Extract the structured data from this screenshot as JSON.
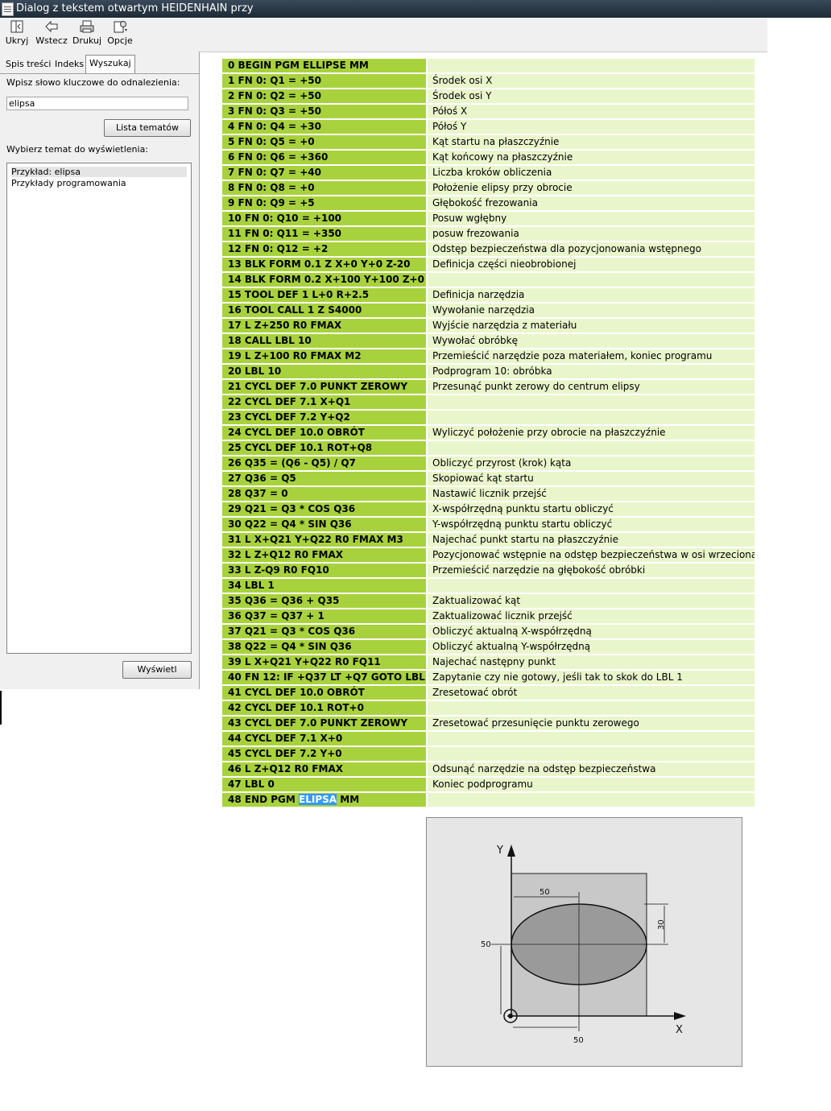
{
  "window": {
    "title": "Dialog z tekstem otwartym HEIDENHAIN przy"
  },
  "toolbar": {
    "hide_label": "Ukryj",
    "back_label": "Wstecz",
    "print_label": "Drukuj",
    "options_label": "Opcje"
  },
  "tabs": [
    {
      "label": "Spis treści"
    },
    {
      "label": "Indeks"
    },
    {
      "label": "Wyszukaj",
      "active": true
    }
  ],
  "search": {
    "prompt": "Wpisz słowo kluczowe do odnalezienia:",
    "value": "elipsa",
    "list_topics_button": "Lista tematów",
    "select_prompt": "Wybierz temat do wyświetlenia:",
    "topics": [
      "Przykład: elipsa",
      "Przykłady programowania"
    ],
    "selected_topic": 0,
    "display_button": "Wyświetl"
  },
  "program": {
    "rows": [
      {
        "code": "0 BEGIN PGM ELLIPSE MM",
        "comment": ""
      },
      {
        "code": "1 FN 0: Q1 = +50",
        "comment": "Środek osi X"
      },
      {
        "code": "2 FN 0: Q2 = +50",
        "comment": "Środek osi Y"
      },
      {
        "code": "3 FN 0: Q3 = +50",
        "comment": "Półoś X"
      },
      {
        "code": "4 FN 0: Q4 = +30",
        "comment": "Półoś Y"
      },
      {
        "code": "5 FN 0: Q5 = +0",
        "comment": "Kąt startu na płaszczyźnie"
      },
      {
        "code": "6 FN 0: Q6 = +360",
        "comment": "Kąt końcowy na płaszczyźnie"
      },
      {
        "code": "7 FN 0: Q7 = +40",
        "comment": "Liczba kroków obliczenia"
      },
      {
        "code": "8 FN 0: Q8 = +0",
        "comment": "Położenie elipsy przy obrocie"
      },
      {
        "code": "9 FN 0: Q9 = +5",
        "comment": "Głębokość frezowania"
      },
      {
        "code": "10 FN 0: Q10 = +100",
        "comment": "Posuw wgłębny"
      },
      {
        "code": "11 FN 0: Q11 = +350",
        "comment": "posuw frezowania"
      },
      {
        "code": "12 FN 0: Q12 = +2",
        "comment": "Odstęp bezpieczeństwa dla pozycjonowania wstępnego"
      },
      {
        "code": "13 BLK FORM 0.1 Z X+0 Y+0 Z-20",
        "comment": "Definicja części nieobrobionej"
      },
      {
        "code": "14 BLK FORM 0.2 X+100 Y+100 Z+0",
        "comment": ""
      },
      {
        "code": "15 TOOL DEF 1 L+0 R+2.5",
        "comment": "Definicja narzędzia"
      },
      {
        "code": "16 TOOL CALL 1 Z S4000",
        "comment": "Wywołanie narzędzia"
      },
      {
        "code": "17 L Z+250 R0 FMAX",
        "comment": "Wyjście narzędzia z materiału"
      },
      {
        "code": "18 CALL LBL 10",
        "comment": "Wywołać obróbkę"
      },
      {
        "code": "19 L Z+100 R0 FMAX M2",
        "comment": "Przemieścić narzędzie poza materiałem, koniec programu"
      },
      {
        "code": "20 LBL 10",
        "comment": "Podprogram 10: obróbka"
      },
      {
        "code": "21 CYCL DEF 7.0 PUNKT ZEROWY",
        "comment": "Przesunąć punkt zerowy do centrum elipsy"
      },
      {
        "code": "22 CYCL DEF 7.1 X+Q1",
        "comment": ""
      },
      {
        "code": "23 CYCL DEF 7.2 Y+Q2",
        "comment": ""
      },
      {
        "code": "24 CYCL DEF 10.0 OBRÓT",
        "comment": "Wyliczyć położenie przy obrocie na płaszczyźnie"
      },
      {
        "code": "25 CYCL DEF 10.1 ROT+Q8",
        "comment": ""
      },
      {
        "code": "26 Q35 = (Q6 - Q5) / Q7",
        "comment": "Obliczyć przyrost (krok) kąta"
      },
      {
        "code": "27 Q36 = Q5",
        "comment": "Skopiować kąt startu"
      },
      {
        "code": "28 Q37 = 0",
        "comment": "Nastawić licznik przejść"
      },
      {
        "code": "29 Q21 = Q3 * COS Q36",
        "comment": "X-współrzędną punktu startu obliczyć"
      },
      {
        "code": "30 Q22 = Q4 * SIN Q36",
        "comment": "Y-współrzędną punktu startu obliczyć"
      },
      {
        "code": "31 L X+Q21 Y+Q22 R0 FMAX M3",
        "comment": "Najechać punkt startu na płaszczyźnie"
      },
      {
        "code": "32 L Z+Q12 R0 FMAX",
        "comment": "Pozycjonować wstępnie na odstęp bezpieczeństwa w osi wrzeciona"
      },
      {
        "code": "33 L Z-Q9 R0 FQ10",
        "comment": "Przemieścić narzędzie na głębokość obróbki"
      },
      {
        "code": "34 LBL 1",
        "comment": ""
      },
      {
        "code": "35 Q36 = Q36 + Q35",
        "comment": "Zaktualizować kąt"
      },
      {
        "code": "36 Q37 = Q37 + 1",
        "comment": "Zaktualizować licznik przejść"
      },
      {
        "code": "37 Q21 = Q3 * COS Q36",
        "comment": "Obliczyć aktualną X-współrzędną"
      },
      {
        "code": "38 Q22 = Q4 * SIN Q36",
        "comment": "Obliczyć aktualną Y-współrzędną"
      },
      {
        "code": "39 L X+Q21 Y+Q22 R0 FQ11",
        "comment": "Najechać następny punkt"
      },
      {
        "code": "40 FN 12: IF +Q37 LT +Q7 GOTO LBL 1",
        "comment": "Zapytanie czy nie gotowy, jeśli tak to skok do LBL 1"
      },
      {
        "code": "41 CYCL DEF 10.0 OBRÓT",
        "comment": "Zresetować obrót"
      },
      {
        "code": "42 CYCL DEF 10.1 ROT+0",
        "comment": ""
      },
      {
        "code": "43 CYCL DEF 7.0 PUNKT ZEROWY",
        "comment": "Zresetować przesunięcie punktu zerowego"
      },
      {
        "code": "44 CYCL DEF 7.1 X+0",
        "comment": ""
      },
      {
        "code": "45 CYCL DEF 7.2 Y+0",
        "comment": ""
      },
      {
        "code": "46 L Z+Q12 R0 FMAX",
        "comment": "Odsunąć narzędzie na odstęp bezpieczeństwa"
      },
      {
        "code": "47 LBL 0",
        "comment": "Koniec podprogramu"
      }
    ],
    "last_row": {
      "prefix": "48 END PGM ",
      "highlight": "ELIPSA",
      "suffix": " MM",
      "comment": ""
    },
    "code_color": "#a8d23d",
    "comment_color": "#e9f6cc",
    "highlight_color": "#3399ff"
  },
  "figure": {
    "y_axis_label": "Y",
    "x_axis_label": "X",
    "dim_top": "50",
    "dim_right": "30",
    "dim_left": "50",
    "dim_bottom": "50"
  }
}
